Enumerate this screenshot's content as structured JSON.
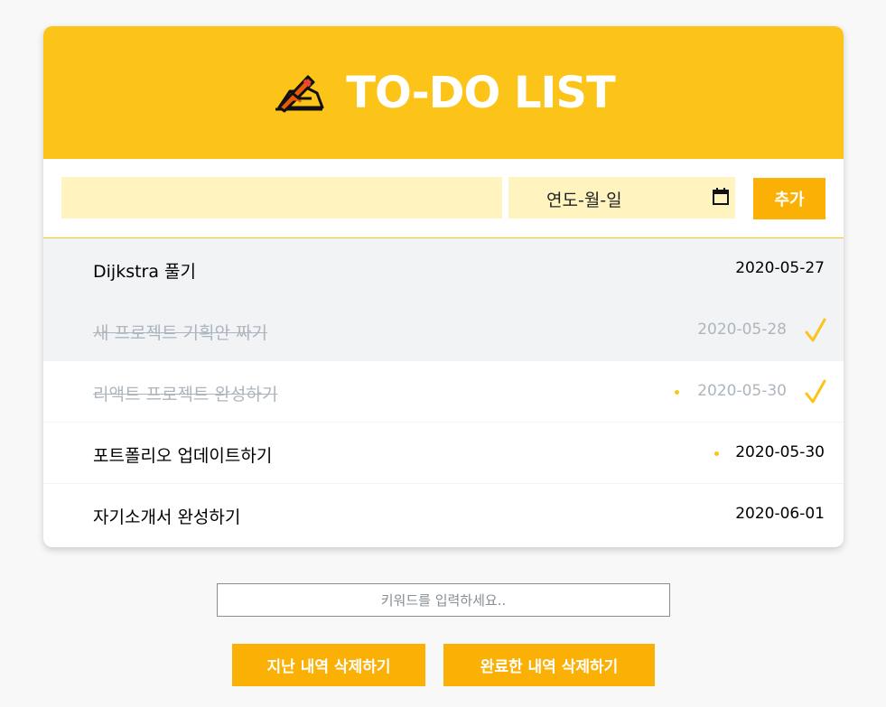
{
  "header": {
    "title": "TO-DO LIST",
    "icon": "writing-hand-icon"
  },
  "form": {
    "todo_value": "",
    "date_placeholder": "연도-월-일",
    "calendar_icon": "calendar-icon",
    "add_label": "추가"
  },
  "todos": [
    {
      "text": "Dijkstra 풀기",
      "date": "2020-05-27",
      "done": false,
      "dot": false,
      "highlighted": true
    },
    {
      "text": "새 프로젝트 기획안 짜기",
      "date": "2020-05-28",
      "done": true,
      "dot": false,
      "highlighted": true
    },
    {
      "text": "리액트 프로젝트 완성하기",
      "date": "2020-05-30",
      "done": true,
      "dot": true,
      "highlighted": false
    },
    {
      "text": "포트폴리오 업데이트하기",
      "date": "2020-05-30",
      "done": false,
      "dot": true,
      "highlighted": false
    },
    {
      "text": "자기소개서 완성하기",
      "date": "2020-06-01",
      "done": false,
      "dot": false,
      "highlighted": false
    }
  ],
  "search": {
    "placeholder": "키워드를 입력하세요..",
    "value": ""
  },
  "actions": {
    "delete_past_label": "지난 내역 삭제하기",
    "delete_done_label": "완료한 내역 삭제하기"
  },
  "colors": {
    "accent": "#fcc419",
    "button": "#fab005",
    "input_bg": "#fff3bf",
    "highlight_row": "#f1f3f5",
    "done_text": "#adb5bd"
  }
}
